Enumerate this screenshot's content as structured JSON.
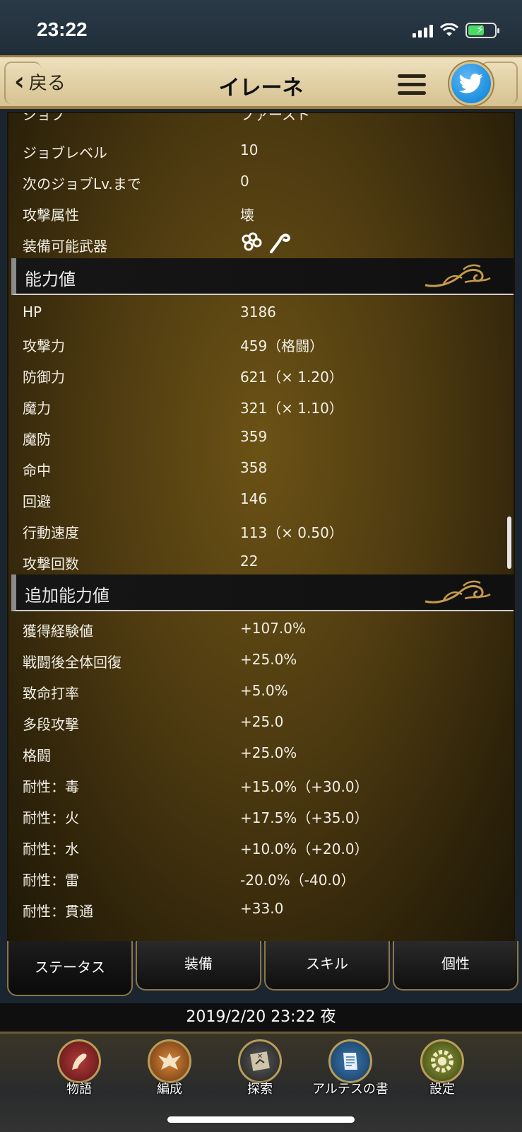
{
  "status_bar": {
    "time": "23:22"
  },
  "header": {
    "back_label": "戻る",
    "title": "イレーネ"
  },
  "basic_rows": [
    {
      "label": "ジョブ",
      "value": "ファースト"
    },
    {
      "label": "ジョブレベル",
      "value": "10"
    },
    {
      "label": "次のジョブLv.まで",
      "value": "0"
    },
    {
      "label": "攻撃属性",
      "value": "壊"
    },
    {
      "label": "装備可能武器",
      "value": ""
    }
  ],
  "sections": {
    "ability": {
      "title": "能力値"
    },
    "extra": {
      "title": "追加能力値"
    }
  },
  "ability_rows": [
    {
      "label": "HP",
      "value": "3186"
    },
    {
      "label": "攻撃力",
      "value": "459（格闘）"
    },
    {
      "label": "防御力",
      "value": "621（× 1.20）"
    },
    {
      "label": "魔力",
      "value": "321（× 1.10）"
    },
    {
      "label": "魔防",
      "value": "359"
    },
    {
      "label": "命中",
      "value": "358"
    },
    {
      "label": "回避",
      "value": "146"
    },
    {
      "label": "行動速度",
      "value": "113（× 0.50）"
    },
    {
      "label": "攻撃回数",
      "value": "22"
    }
  ],
  "extra_rows": [
    {
      "label": "獲得経験値",
      "value": "+107.0%"
    },
    {
      "label": "戦闘後全体回復",
      "value": "+25.0%"
    },
    {
      "label": "致命打率",
      "value": "+5.0%"
    },
    {
      "label": "多段攻撃",
      "value": "+25.0"
    },
    {
      "label": "格闘",
      "value": "+25.0%"
    },
    {
      "label": "耐性：毒",
      "value": "+15.0%（+30.0）"
    },
    {
      "label": "耐性：火",
      "value": "+17.5%（+35.0）"
    },
    {
      "label": "耐性：水",
      "value": "+10.0%（+20.0）"
    },
    {
      "label": "耐性：雷",
      "value": "-20.0%（-40.0）"
    },
    {
      "label": "耐性：貫通",
      "value": "+33.0"
    }
  ],
  "tabs": [
    {
      "label": "ステータス",
      "active": true
    },
    {
      "label": "装備",
      "active": false
    },
    {
      "label": "スキル",
      "active": false
    },
    {
      "label": "個性",
      "active": false
    }
  ],
  "date_bar": "2019/2/20  23:22 夜",
  "bottom_nav": [
    {
      "label": "物語",
      "icon": "story-icon",
      "color": "#8e2a2a"
    },
    {
      "label": "編成",
      "icon": "formation-icon",
      "color": "#b86a1e"
    },
    {
      "label": "探索",
      "icon": "explore-icon",
      "color": "#5a5a5a"
    },
    {
      "label": "アルテスの書",
      "icon": "book-icon",
      "color": "#2c5d8a"
    },
    {
      "label": "設定",
      "icon": "settings-icon",
      "color": "#6c7a2a"
    }
  ],
  "colors": {
    "header_bg": "#e2d1a6",
    "panel_bg": "#4d3a10",
    "section_bar": "#101010",
    "twitter": "#1d8fe0"
  }
}
